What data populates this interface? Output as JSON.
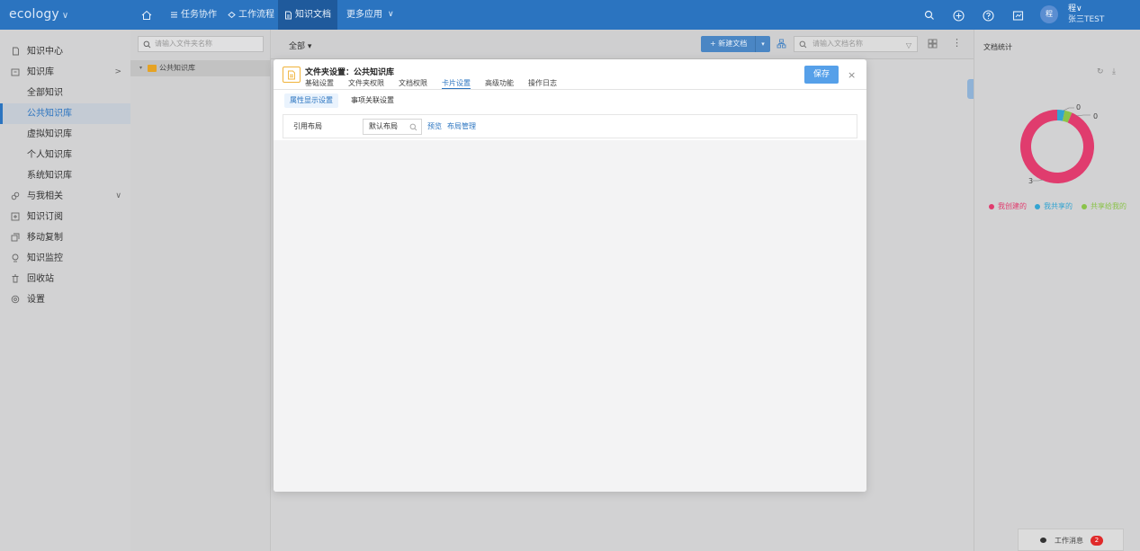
{
  "app": {
    "logo": "ecology",
    "logo_chevron": "∨"
  },
  "topnav": {
    "items": [
      {
        "label": "任务协作",
        "icon": "list-icon"
      },
      {
        "label": "工作流程",
        "icon": "flow-icon"
      },
      {
        "label": "知识文档",
        "icon": "document-icon",
        "active": true
      },
      {
        "label": "更多应用",
        "icon": "chevron-down-icon"
      }
    ],
    "more_chevron": "∨"
  },
  "user": {
    "avatar_text": "程",
    "name": "程∨",
    "sub": "张三TEST"
  },
  "sidebar": {
    "items": [
      {
        "label": "知识中心",
        "icon": "doc-icon"
      },
      {
        "label": "知识库",
        "icon": "archive-icon",
        "arrow": ">"
      },
      {
        "label": "全部知识"
      },
      {
        "label": "公共知识库",
        "active": true
      },
      {
        "label": "虚拟知识库"
      },
      {
        "label": "个人知识库"
      },
      {
        "label": "系统知识库"
      },
      {
        "label": "与我相关",
        "icon": "link-icon",
        "arrow": "∨"
      },
      {
        "label": "知识订阅",
        "icon": "subscribe-icon"
      },
      {
        "label": "移动复制",
        "icon": "copy-icon"
      },
      {
        "label": "知识监控",
        "icon": "monitor-icon"
      },
      {
        "label": "回收站",
        "icon": "trash-icon"
      },
      {
        "label": "设置",
        "icon": "settings-icon"
      }
    ]
  },
  "tree": {
    "search_placeholder": "请输入文件夹名称",
    "node_label": "公共知识库",
    "node_arrow": "▾"
  },
  "toolbar": {
    "filter_label": "全部 ▾",
    "new_doc_label": "+ 新建文档",
    "new_doc_arrow": "▾",
    "search_placeholder": "请输入文档名称",
    "filter_icon_glyph": "▽",
    "more_glyph": "⋮"
  },
  "rpanel": {
    "title": "文档统计",
    "refresh_glyph": "↻",
    "download_glyph": "⤓",
    "pie_labels": [
      "0",
      "0",
      "3"
    ],
    "legend": [
      {
        "label": "我创建的",
        "color": "#e03c6e"
      },
      {
        "label": "我共享的",
        "color": "#33a4d1"
      },
      {
        "label": "共享给我的",
        "color": "#8ac34a"
      }
    ]
  },
  "chart_data": {
    "type": "pie",
    "categories": [
      "我创建的",
      "我共享的",
      "共享给我的"
    ],
    "values": [
      3,
      0,
      0
    ]
  },
  "work_message": {
    "label": "工作消息",
    "count": "2"
  },
  "modal": {
    "title": "文件夹设置：公共知识库",
    "tabs": [
      "基础设置",
      "文件夹权限",
      "文档权限",
      "卡片设置",
      "高级功能",
      "操作日志"
    ],
    "active_tab": "卡片设置",
    "save_label": "保存",
    "close_glyph": "×",
    "sub_tabs": [
      "属性显示设置",
      "事项关联设置"
    ],
    "field": {
      "label": "引用布局",
      "value": "默认布局",
      "link_preview": "预览",
      "link_manage": "布局管理"
    }
  }
}
